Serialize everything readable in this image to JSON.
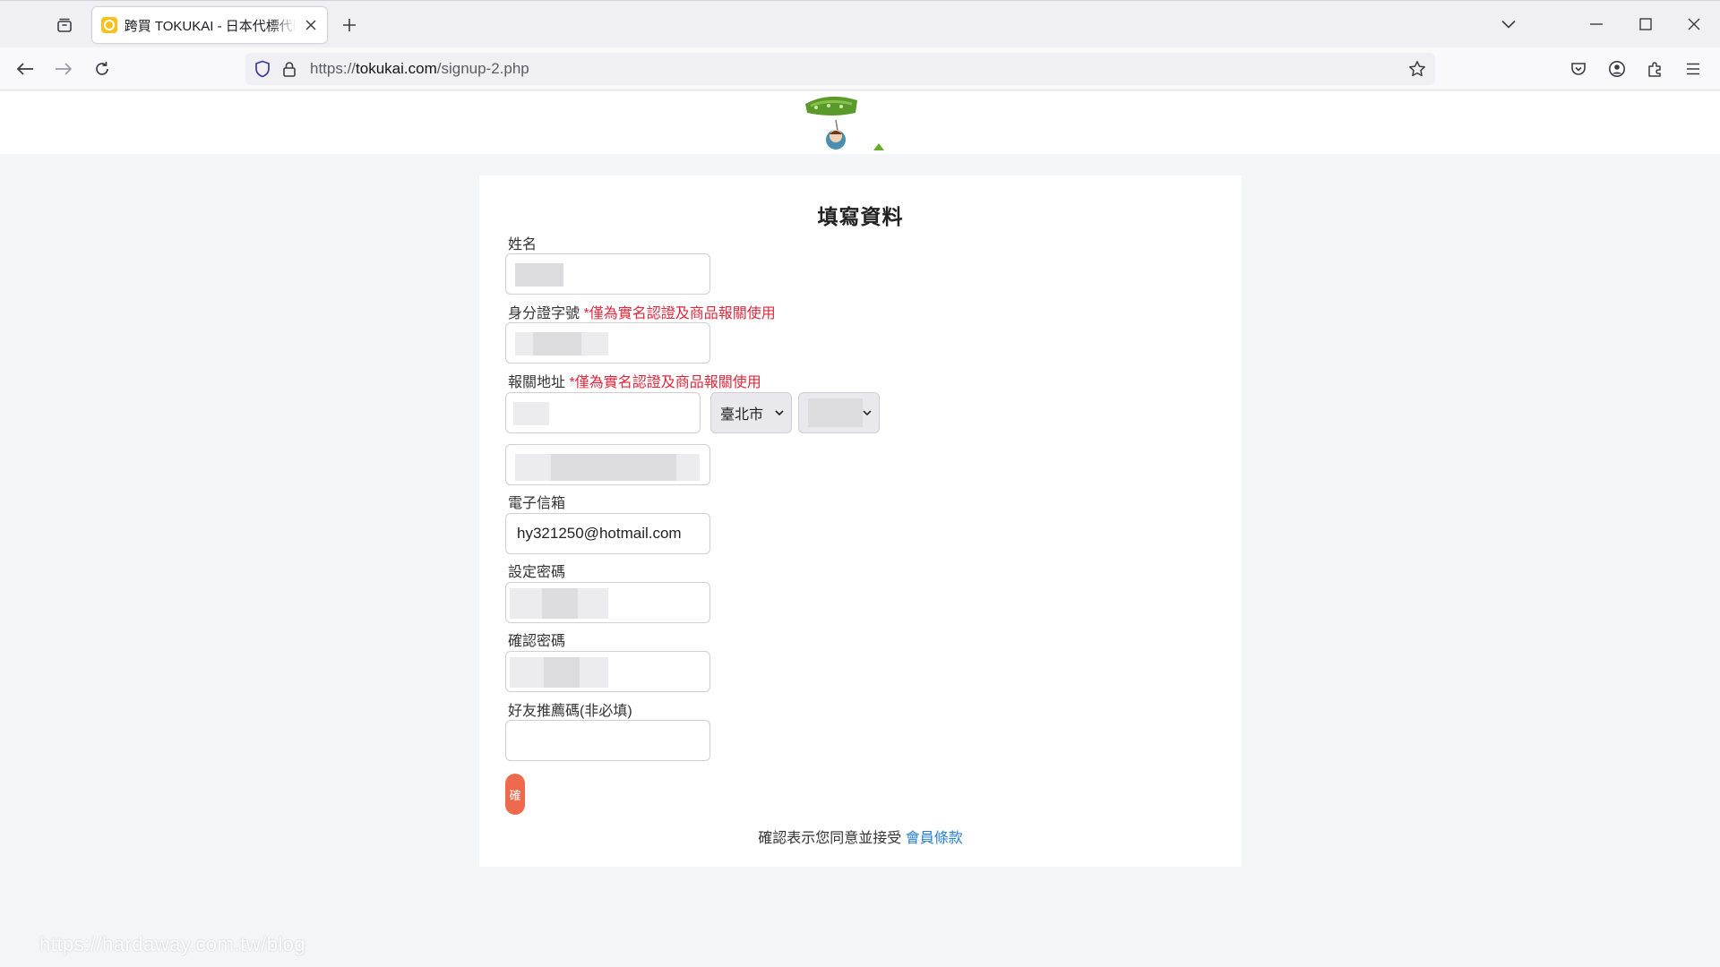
{
  "browser": {
    "tab_title": "跨買 TOKUKAI - 日本代標代購",
    "url_prefix": "https://",
    "url_host": "tokukai.com",
    "url_path": "/signup-2.php"
  },
  "form": {
    "title": "填寫資料",
    "name_label": "姓名",
    "id_label": "身分證字號",
    "id_note": "*僅為實名認證及商品報關使用",
    "address_label": "報關地址",
    "address_note": "*僅為實名認證及商品報關使用",
    "city_value": "臺北市",
    "email_label": "電子信箱",
    "email_value": "hy321250@hotmail.com",
    "password_label": "設定密碼",
    "confirm_label": "確認密碼",
    "referral_label": "好友推薦碼(非必填)",
    "submit_label": "確",
    "terms_text": "確認表示您同意並接受",
    "terms_link": "會員條款"
  },
  "watermark": "https://hardaway.com.tw/blog",
  "colors": {
    "accent_button": "#ef6a4d",
    "note_red": "#e0283c",
    "link_blue": "#2a7fd4"
  }
}
